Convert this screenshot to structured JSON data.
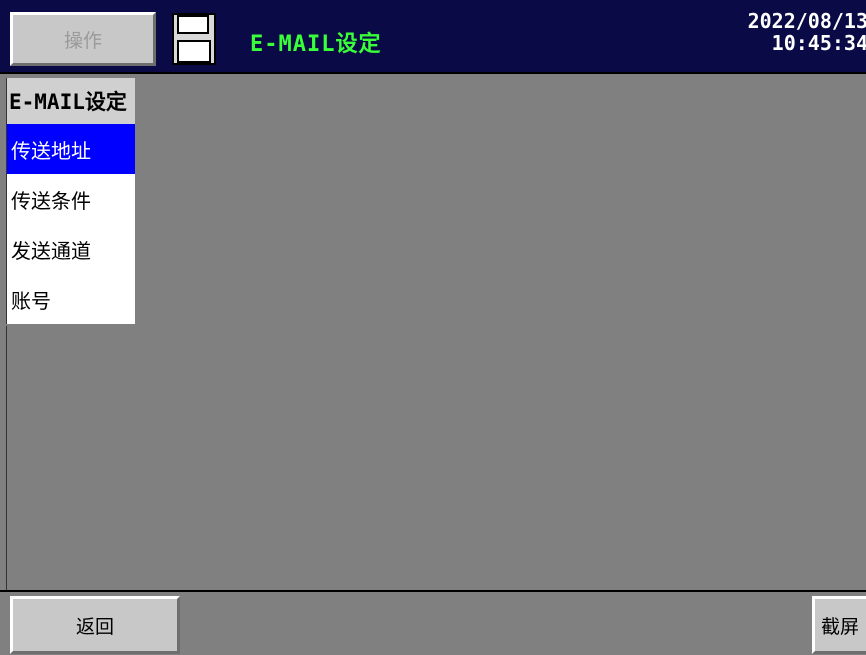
{
  "header": {
    "operate_label": "操作",
    "screen_title": "E-MAIL设定",
    "date": "2022/08/13",
    "time": "10:45:34"
  },
  "menu": {
    "title": "E-MAIL设定",
    "items": [
      {
        "label": "传送地址",
        "selected": true
      },
      {
        "label": "传送条件",
        "selected": false
      },
      {
        "label": "发送通道",
        "selected": false
      },
      {
        "label": "账号",
        "selected": false
      }
    ]
  },
  "footer": {
    "back_label": "返回",
    "screenshot_label": "截屏"
  },
  "icons": {
    "save": "floppy-disk-icon"
  },
  "colors": {
    "header_bg": "#0a0a46",
    "title_green": "#38ff38",
    "selected_blue": "#0000ff",
    "workspace_gray": "#808080"
  }
}
